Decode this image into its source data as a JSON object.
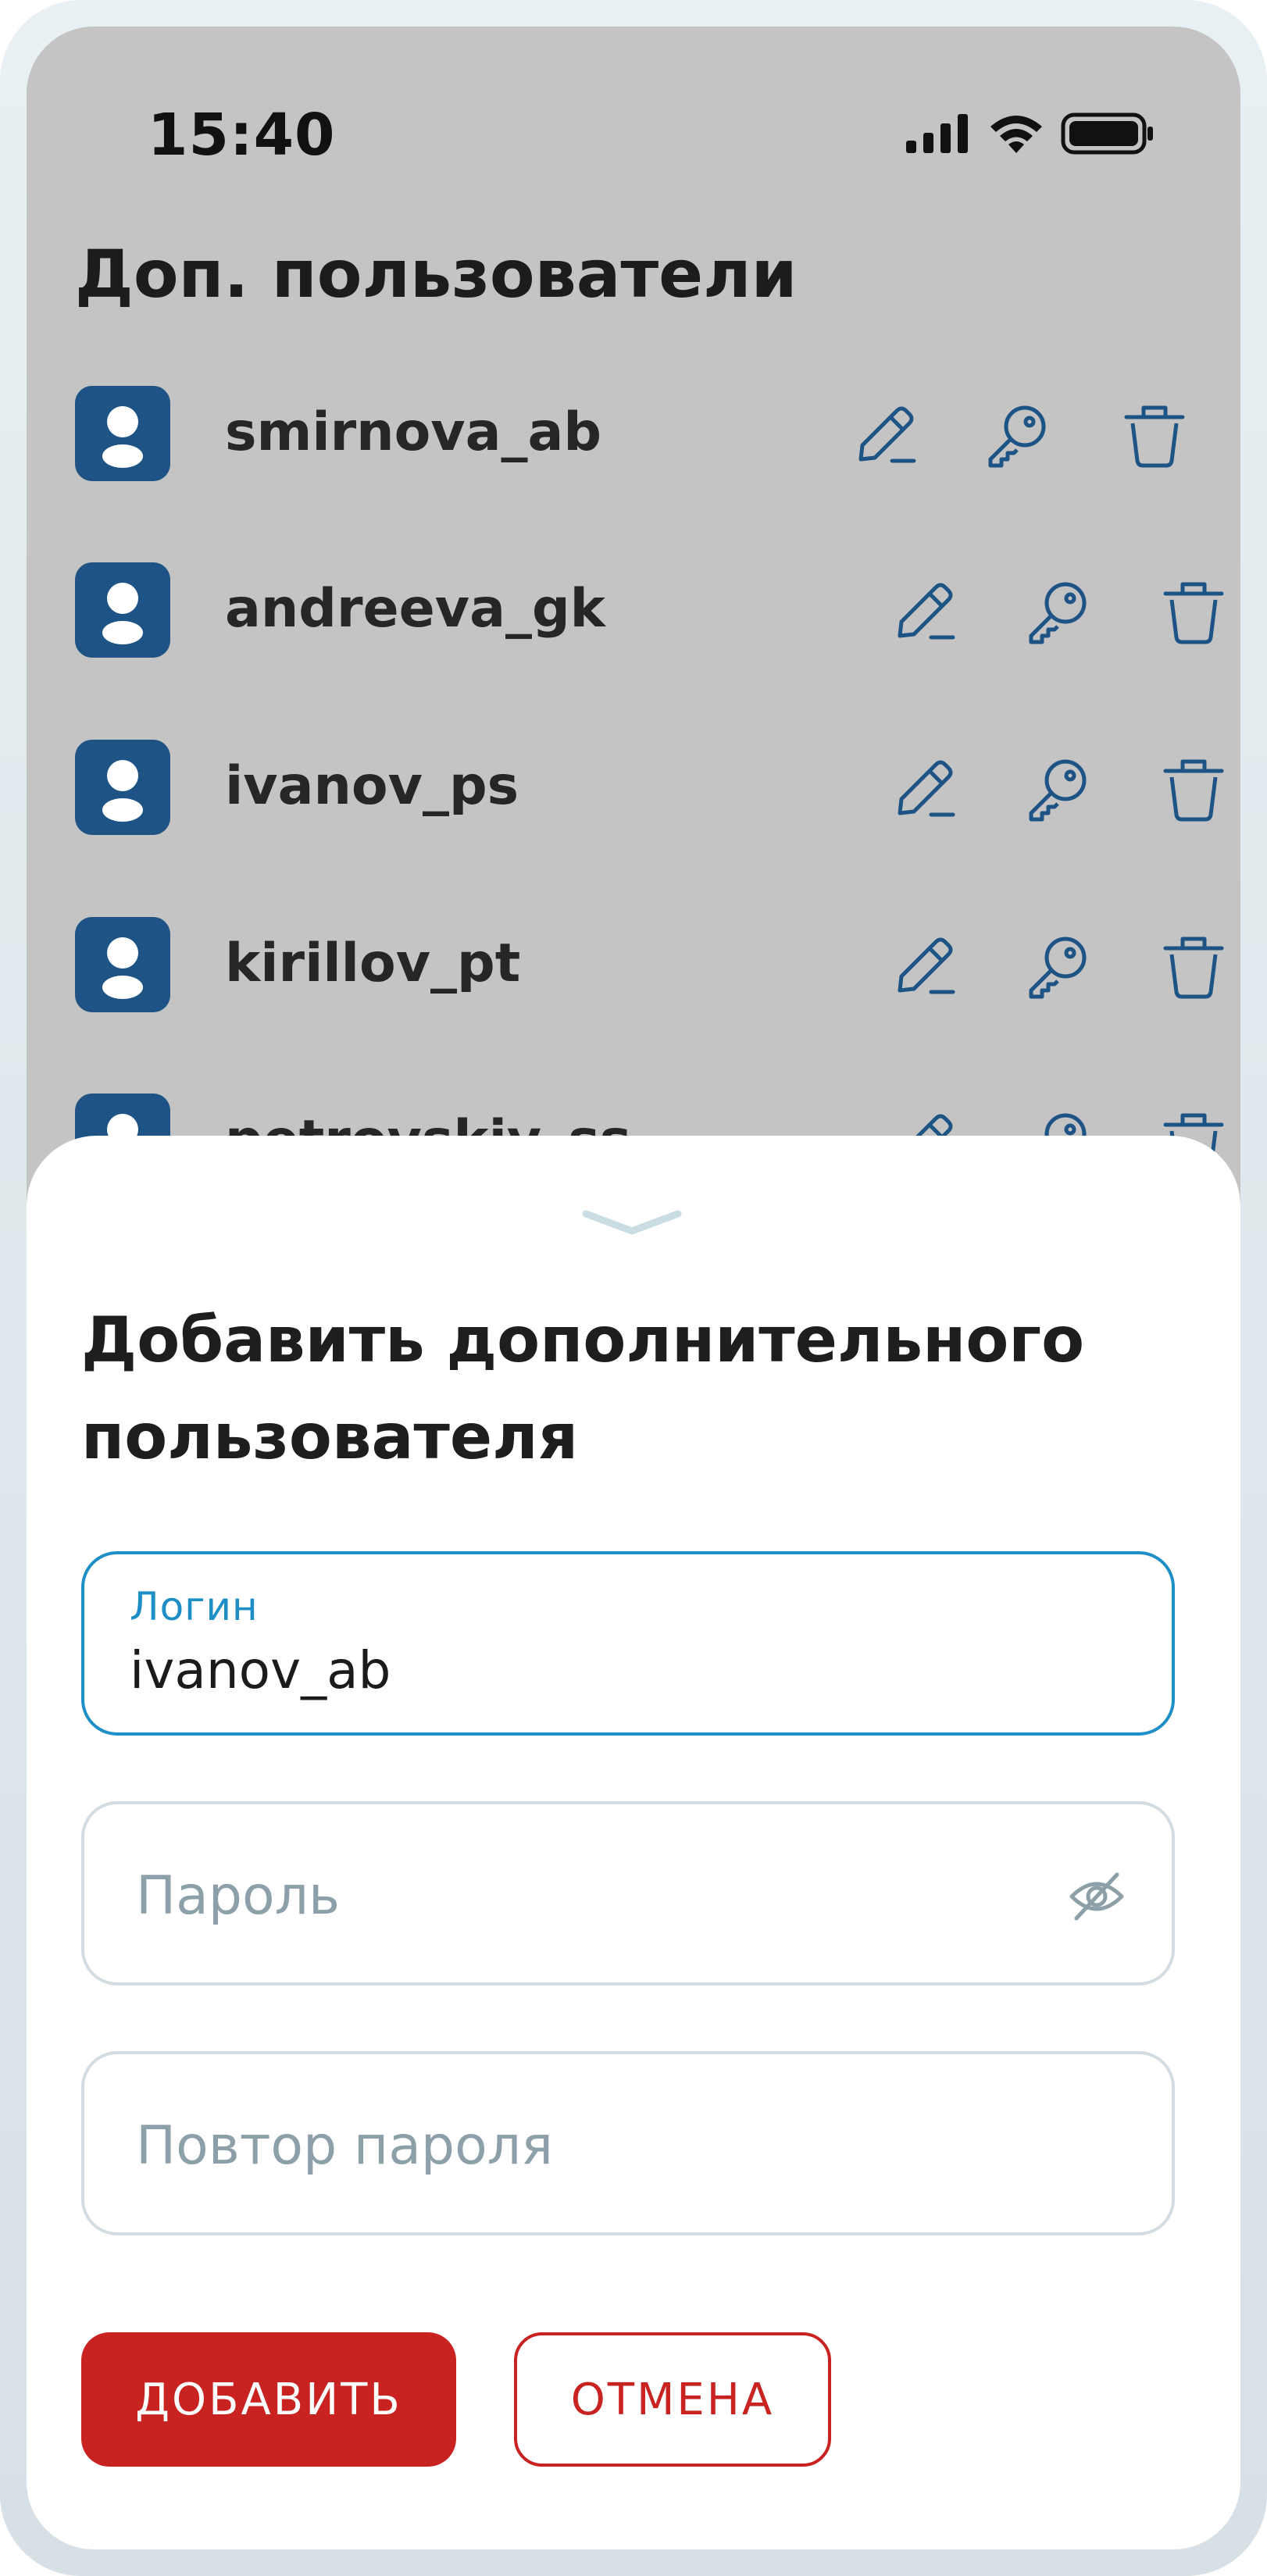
{
  "status_bar": {
    "time": "15:40",
    "icons": [
      "signal-icon",
      "wifi-icon",
      "battery-icon"
    ]
  },
  "page": {
    "title": "Доп. пользователи"
  },
  "users": [
    {
      "login": "smirnova_ab"
    },
    {
      "login": "andreeva_gk"
    },
    {
      "login": "ivanov_ps"
    },
    {
      "login": "kirillov_pt"
    },
    {
      "login": "petrovskiy_ss"
    }
  ],
  "row_actions": [
    "edit-icon",
    "key-icon",
    "trash-icon"
  ],
  "sheet": {
    "title": "Добавить дополнительного пользователя",
    "login_field": {
      "label": "Логин",
      "value": "ivanov_ab"
    },
    "password_field": {
      "placeholder": "Пароль"
    },
    "repeat_password_field": {
      "placeholder": "Повтор пароля"
    },
    "add_button": "ДОБАВИТЬ",
    "cancel_button": "ОТМЕНА"
  },
  "colors": {
    "accent_blue": "#1d5485",
    "field_focus": "#1e8fc6",
    "primary_red": "#c82221",
    "overlay_gray": "#c4c4c4"
  }
}
